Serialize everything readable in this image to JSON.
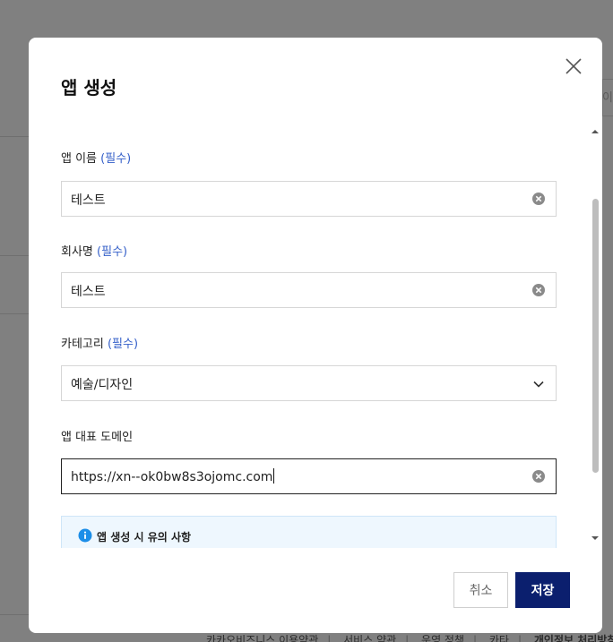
{
  "background": {
    "right_text": "이름",
    "footer_links": [
      "카카오비즈니스 이용약관",
      "서비스 약관",
      "운영 정책",
      "카타",
      "개인정보 처리방침"
    ]
  },
  "modal": {
    "title": "앱 생성",
    "close_icon": "close-icon",
    "fields": {
      "app_name": {
        "label": "앱 이름",
        "required": "(필수)",
        "value": "테스트",
        "icon": "clear-icon"
      },
      "company": {
        "label": "회사명",
        "required": "(필수)",
        "value": "테스트",
        "icon": "clear-icon"
      },
      "category": {
        "label": "카테고리",
        "required": "(필수)",
        "value": "예술/디자인",
        "icon": "chevron-down-icon"
      },
      "domain": {
        "label": "앱 대표 도메인",
        "value": "https://xn--ok0bw8s3ojomc.com",
        "icon": "clear-icon"
      }
    },
    "notice": {
      "icon": "info-icon",
      "title": "앱 생성 시 유의 사항"
    },
    "buttons": {
      "cancel": "취소",
      "save": "저장"
    },
    "colors": {
      "primary": "#0b1f6e",
      "required": "#3560c9",
      "notice_bg": "#eef7fe",
      "info_icon": "#1c8ee8"
    }
  }
}
